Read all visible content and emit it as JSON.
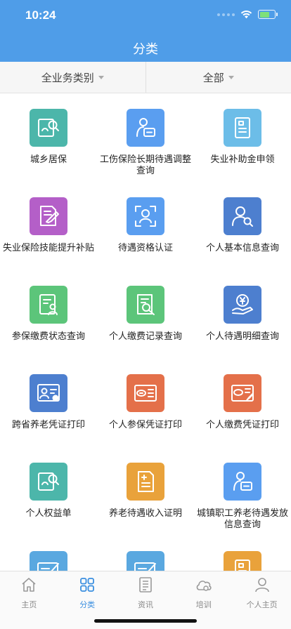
{
  "status": {
    "time": "10:24"
  },
  "header": {
    "title": "分类"
  },
  "filters": [
    {
      "label": "全业务类别"
    },
    {
      "label": "全部"
    }
  ],
  "colors": {
    "header": "#4f9de8",
    "teal": "#4cb6aa",
    "blue": "#5a9ef0",
    "lightblue": "#6cbde8",
    "purple": "#b45fc8",
    "green": "#5cc57a",
    "navy": "#4d7fcf",
    "orange": "#e4704a",
    "amber": "#e9a23b",
    "active_tab": "#3b8fe0"
  },
  "services": [
    {
      "label": "城乡居保",
      "icon": "card-search-icon",
      "color": "#4cb6aa"
    },
    {
      "label": "工伤保险长期待遇调整查询",
      "icon": "person-card-icon",
      "color": "#5a9ef0"
    },
    {
      "label": "失业补助金申领",
      "icon": "document-icon",
      "color": "#6cbde8"
    },
    {
      "label": "失业保险技能提升补贴",
      "icon": "document-edit-icon",
      "color": "#b45fc8"
    },
    {
      "label": "待遇资格认证",
      "icon": "face-scan-icon",
      "color": "#5a9ef0"
    },
    {
      "label": "个人基本信息查询",
      "icon": "user-search-icon",
      "color": "#4d7fcf"
    },
    {
      "label": "参保缴费状态查询",
      "icon": "list-person-icon",
      "color": "#5cc57a"
    },
    {
      "label": "个人缴费记录查询",
      "icon": "doc-search-icon",
      "color": "#5cc57a"
    },
    {
      "label": "个人待遇明细查询",
      "icon": "yuan-hand-icon",
      "color": "#4d7fcf"
    },
    {
      "label": "跨省养老凭证打印",
      "icon": "id-card-edit-icon",
      "color": "#4d7fcf"
    },
    {
      "label": "个人参保凭证打印",
      "icon": "bank-card-icon",
      "color": "#e4704a"
    },
    {
      "label": "个人缴费凭证打印",
      "icon": "bank-card-edit-icon",
      "color": "#e4704a"
    },
    {
      "label": "个人权益单",
      "icon": "card-search-icon",
      "color": "#4cb6aa"
    },
    {
      "label": "养老待遇收入证明",
      "icon": "plus-doc-icon",
      "color": "#e9a23b"
    },
    {
      "label": "城镇职工养老待遇发放信息查询",
      "icon": "person-card-icon",
      "color": "#5a9ef0"
    },
    {
      "label": "",
      "icon": "pen-card-icon",
      "color": "#5aa8e0"
    },
    {
      "label": "",
      "icon": "pen-card-icon",
      "color": "#5aa8e0"
    },
    {
      "label": "",
      "icon": "document-icon",
      "color": "#e9a23b"
    }
  ],
  "tabs": [
    {
      "label": "主页",
      "icon": "home-icon",
      "active": false
    },
    {
      "label": "分类",
      "icon": "grid-icon",
      "active": true
    },
    {
      "label": "资讯",
      "icon": "news-icon",
      "active": false
    },
    {
      "label": "培训",
      "icon": "cloud-icon",
      "active": false
    },
    {
      "label": "个人主页",
      "icon": "user-icon",
      "active": false
    }
  ]
}
